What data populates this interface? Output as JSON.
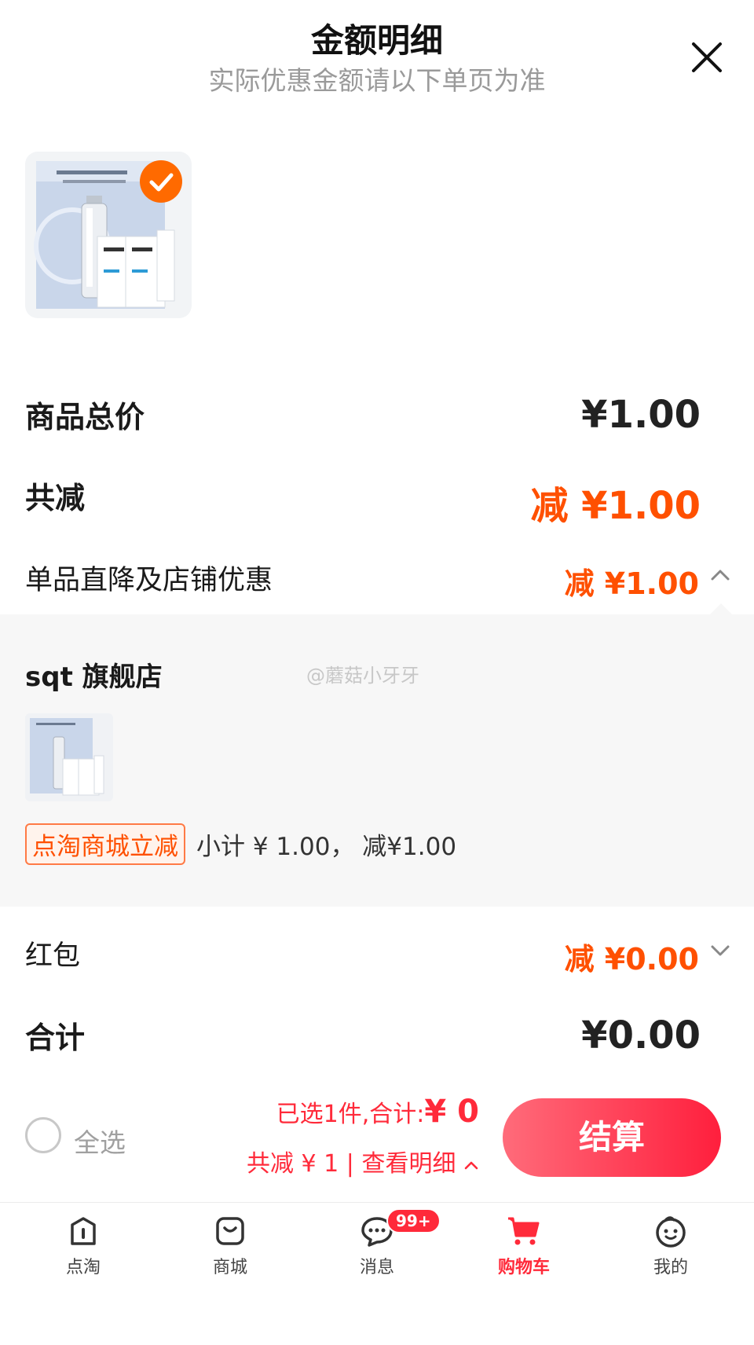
{
  "header": {
    "title": "金额明细",
    "subtitle": "实际优惠金额请以下单页为准"
  },
  "summary": {
    "total_label": "商品总价",
    "total_value": "¥1.00",
    "discount_label": "共减",
    "discount_value": "减 ¥1.00",
    "store_discount_label": "单品直降及店铺优惠",
    "store_discount_value": "减 ¥1.00",
    "red_packet_label": "红包",
    "red_packet_value": "减 ¥0.00",
    "final_label": "合计",
    "final_value": "¥0.00"
  },
  "store": {
    "name": "sqt 旗舰店",
    "watermark": "@蘑菇小牙牙",
    "promo_tag": "点淘商城立减",
    "subtotal_text": "小计 ¥ 1.00，  减¥1.00"
  },
  "checkout": {
    "select_all": "全选",
    "selected_prefix": "已选1件,合计:",
    "selected_amount": "¥ 0",
    "discount_text": "共减 ¥ 1 | 查看明细",
    "button": "结算"
  },
  "tabs": [
    {
      "label": "点淘",
      "icon": "dian-tao-icon"
    },
    {
      "label": "商城",
      "icon": "shopping-bag-icon"
    },
    {
      "label": "消息",
      "icon": "message-icon"
    },
    {
      "label": "购物车",
      "icon": "cart-icon"
    },
    {
      "label": "我的",
      "icon": "profile-icon"
    }
  ],
  "message_badge": "99+",
  "colors": {
    "accent_orange": "#ff5000",
    "accent_red": "#ff2a3a",
    "check_badge": "#ff6a00"
  }
}
